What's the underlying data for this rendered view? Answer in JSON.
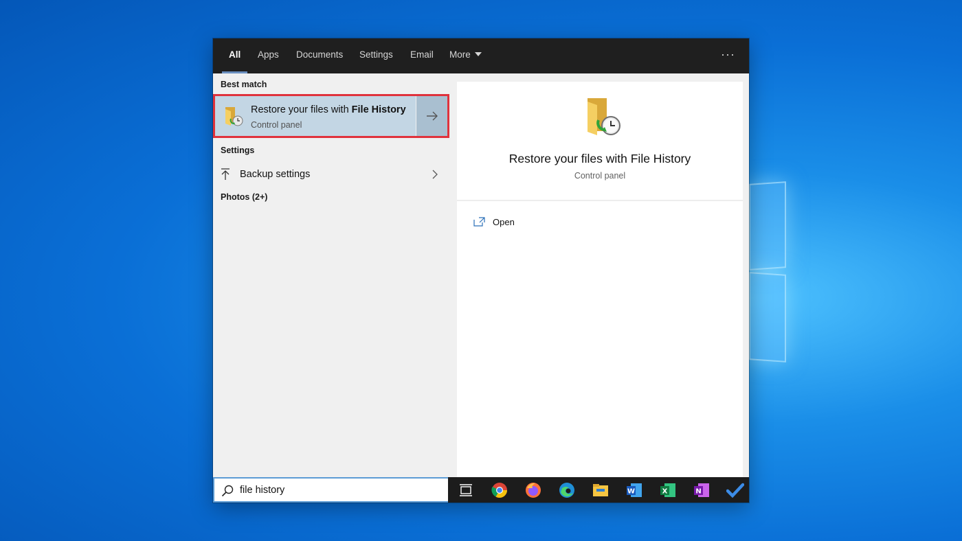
{
  "tabs": [
    {
      "label": "All",
      "active": true
    },
    {
      "label": "Apps"
    },
    {
      "label": "Documents"
    },
    {
      "label": "Settings"
    },
    {
      "label": "Email"
    },
    {
      "label": "More"
    }
  ],
  "more_options_icon": "ellipsis-icon",
  "left": {
    "best_match_heading": "Best match",
    "best_match": {
      "title_prefix": "Restore your files with ",
      "title_bold": "File History",
      "subtitle": "Control panel"
    },
    "settings_heading": "Settings",
    "settings_item": "Backup settings",
    "photos_heading": "Photos (2+)"
  },
  "preview": {
    "title": "Restore your files with File History",
    "subtitle": "Control panel",
    "action_open": "Open"
  },
  "search": {
    "query": "file history"
  },
  "taskbar_icons": [
    "task-view-icon",
    "chrome-icon",
    "firefox-icon",
    "edge-icon",
    "file-explorer-icon",
    "word-icon",
    "excel-icon",
    "onenote-icon",
    "todo-icon"
  ],
  "colors": {
    "selection": "#c3d6e4",
    "highlight_outline": "#e0323c",
    "search_border": "#5b9bd5"
  }
}
